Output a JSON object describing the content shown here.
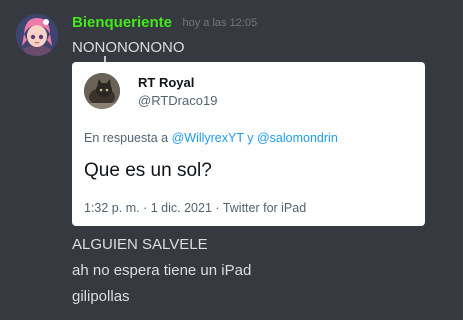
{
  "author": {
    "username": "Bienqueriente",
    "timestamp": "hoy a las 12:05",
    "username_color": "#42e81c",
    "avatar_icon": "anime-avatar"
  },
  "messages": [
    "NONONONONO",
    "ALGUIEN SALVELE",
    "ah no espera tiene un iPad",
    "gilipollas"
  ],
  "tweet_embed": {
    "avatar_icon": "cat-avatar",
    "display_name": "RT Royal",
    "handle": "@RTDraco19",
    "reply_prefix": "En respuesta a",
    "reply_mention_1": "@WillyrexYT",
    "reply_and": "y",
    "reply_mention_2": "@salomondrin",
    "text": "Que es un sol?",
    "time": "1:32 p. m.",
    "separator": "·",
    "date": "1 dic. 2021",
    "source": "Twitter for iPad",
    "mention_color": "#1d9bf0"
  },
  "colors": {
    "background": "#36393f",
    "message_text": "#dcddde",
    "timestamp": "#72767d",
    "embed_background": "#ffffff"
  }
}
